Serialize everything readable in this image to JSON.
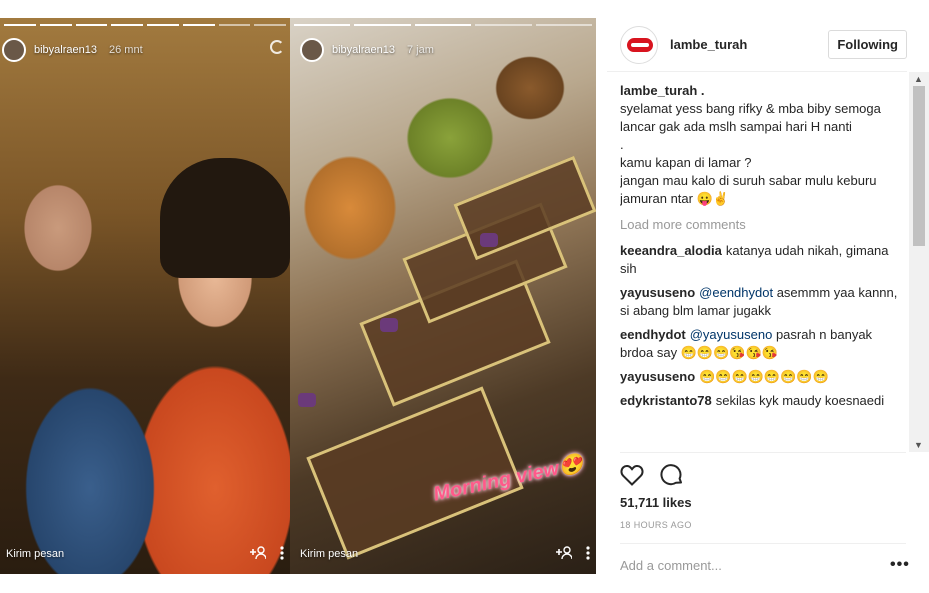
{
  "stories": [
    {
      "username": "bibyalraen13",
      "time": "26 mnt",
      "send_message": "Kirim pesan",
      "add_icon": "add-person-icon",
      "more_icon": "more-vertical-icon"
    },
    {
      "username": "bibyalraen13",
      "time": "7 jam",
      "send_message": "Kirim pesan",
      "sticker_text": "Morning view😍",
      "add_icon": "add-person-icon",
      "more_icon": "more-vertical-icon"
    }
  ],
  "post": {
    "header": {
      "username": "lambe_turah",
      "follow_label": "Following"
    },
    "caption": {
      "username": "lambe_turah .",
      "text": "syelamat yess bang rifky & mba biby semoga lancar gak ada mslh sampai hari H nanti\n.\nkamu kapan di lamar ?\njangan mau kalo di suruh sabar mulu keburu jamuran ntar 😛✌"
    },
    "load_more": "Load more comments",
    "comments": [
      {
        "user": "keeandra_alodia",
        "mention": "",
        "text": "katanya udah nikah, gimana sih"
      },
      {
        "user": "yayususeno",
        "mention": "@eendhydot",
        "text": "asemmm yaa kannn, si abang blm lamar jugakk"
      },
      {
        "user": "eendhydot",
        "mention": "@yayususeno",
        "text": "pasrah n banyak brdoa say 😁😁😁😘😘😘"
      },
      {
        "user": "yayususeno",
        "mention": "",
        "text": "😁😁😁😁😁😁😁😁"
      },
      {
        "user": "edykristanto78",
        "mention": "",
        "text": "sekilas kyk maudy koesnaedi"
      }
    ],
    "likes": "51,711 likes",
    "time_ago": "18 HOURS AGO",
    "comment_placeholder": "Add a comment...",
    "more_label": "•••"
  },
  "colors": {
    "mention": "#003569",
    "muted": "#999999",
    "text": "#262626",
    "sticker": "#ff5a8a"
  }
}
